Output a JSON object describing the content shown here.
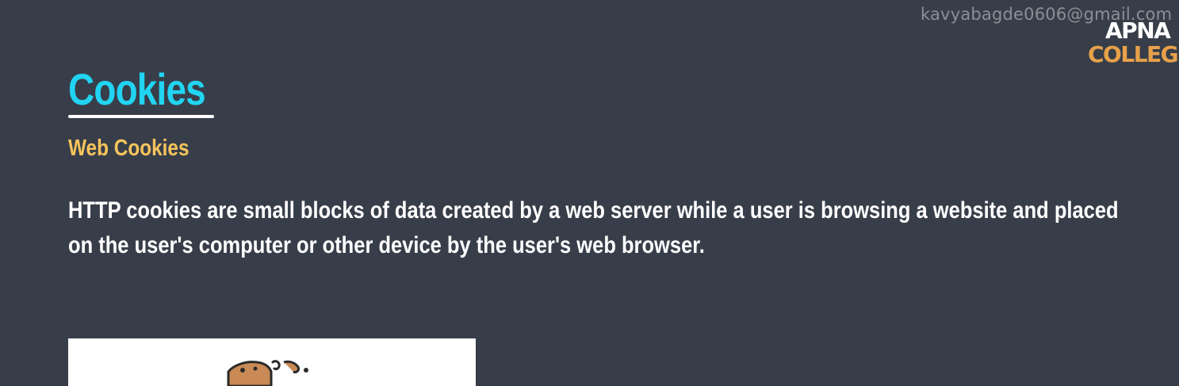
{
  "watermark": {
    "email": "kavyabagde0606@gmail.com"
  },
  "logo": {
    "line1": "APNA",
    "line2": "COLLEGE"
  },
  "slide": {
    "title": "Cookies",
    "subtitle": "Web Cookies",
    "body": "HTTP cookies are small blocks of data created by a web server while a user is browsing a website and placed on the user's computer or other device by the user's web browser."
  },
  "colors": {
    "background": "#383e49",
    "title": "#21d4f2",
    "subtitle": "#f6c45c",
    "body": "#ffffff",
    "logo_accent": "#e8a14a"
  },
  "illustration": {
    "icon": "cookie-icon"
  }
}
